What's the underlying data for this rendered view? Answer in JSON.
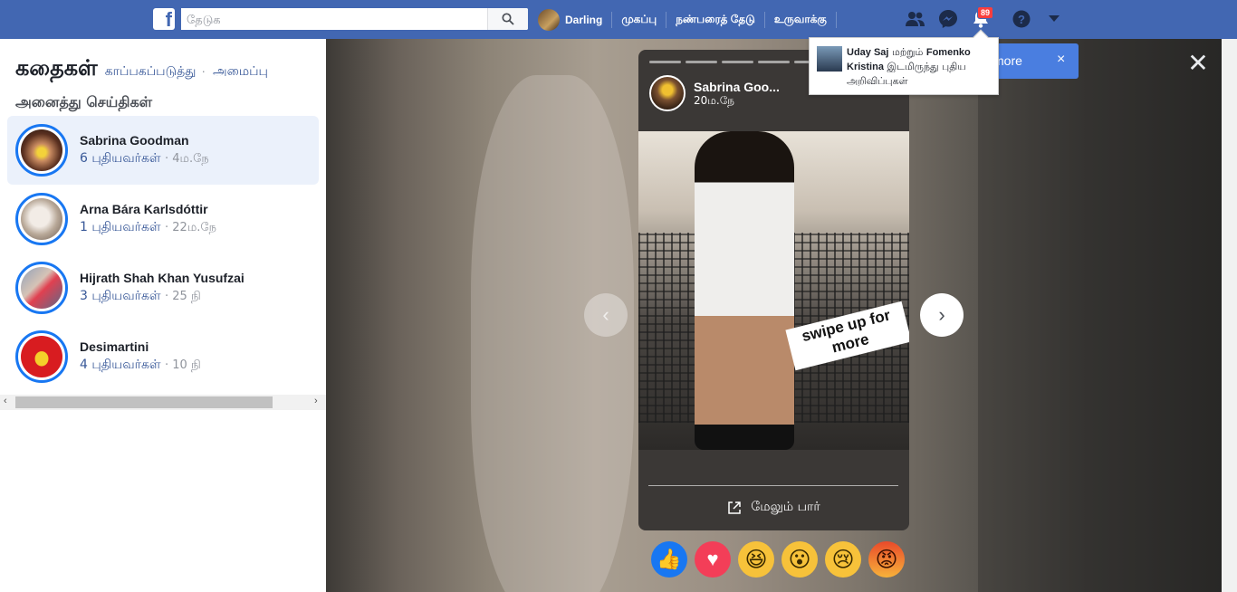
{
  "topbar": {
    "search_placeholder": "தேடுக",
    "user_name": "Darling",
    "nav": [
      "முகப்பு",
      "நண்பரைத் தேடு",
      "உருவாக்கு"
    ],
    "notification_count": "89",
    "brand_color": "#4267b2"
  },
  "sidebar": {
    "title": "கதைகள்",
    "links": [
      "காப்பகப்படுத்து",
      "அமைப்பு"
    ],
    "section_title": "அனைத்து செய்திகள்",
    "stories": [
      {
        "name": "Sabrina Goodman",
        "count": "6 புதியவர்கள்",
        "time": "4ம.நே"
      },
      {
        "name": "Arna Bára Karlsdóttir",
        "count": "1 புதியவர்கள்",
        "time": "22ம.நே"
      },
      {
        "name": "Hijrath Shah Khan Yusufzai",
        "count": "3 புதியவர்கள்",
        "time": "25 நி"
      },
      {
        "name": "Desimartini",
        "count": "4 புதியவர்கள்",
        "time": "10 நி"
      }
    ]
  },
  "story": {
    "author": "Sabrina Goo...",
    "time": "20ம.நே",
    "sticker_line1": "swipe up for",
    "sticker_line2": "more",
    "see_more": "மேலும் பார்"
  },
  "toast": {
    "text": "more",
    "close": "×"
  },
  "notification": {
    "name1": "Uday Saj",
    "connector": "மற்றும்",
    "name2": "Fomenko Kristina",
    "rest": "இடமிருந்து புதிய அறிவிப்புகள்"
  },
  "icons": [
    "facebook-logo-icon",
    "search-icon",
    "friends-icon",
    "messenger-icon",
    "bell-icon",
    "help-icon",
    "caret-down-icon",
    "close-icon",
    "chevron-left-icon",
    "chevron-right-icon",
    "external-link-icon"
  ]
}
